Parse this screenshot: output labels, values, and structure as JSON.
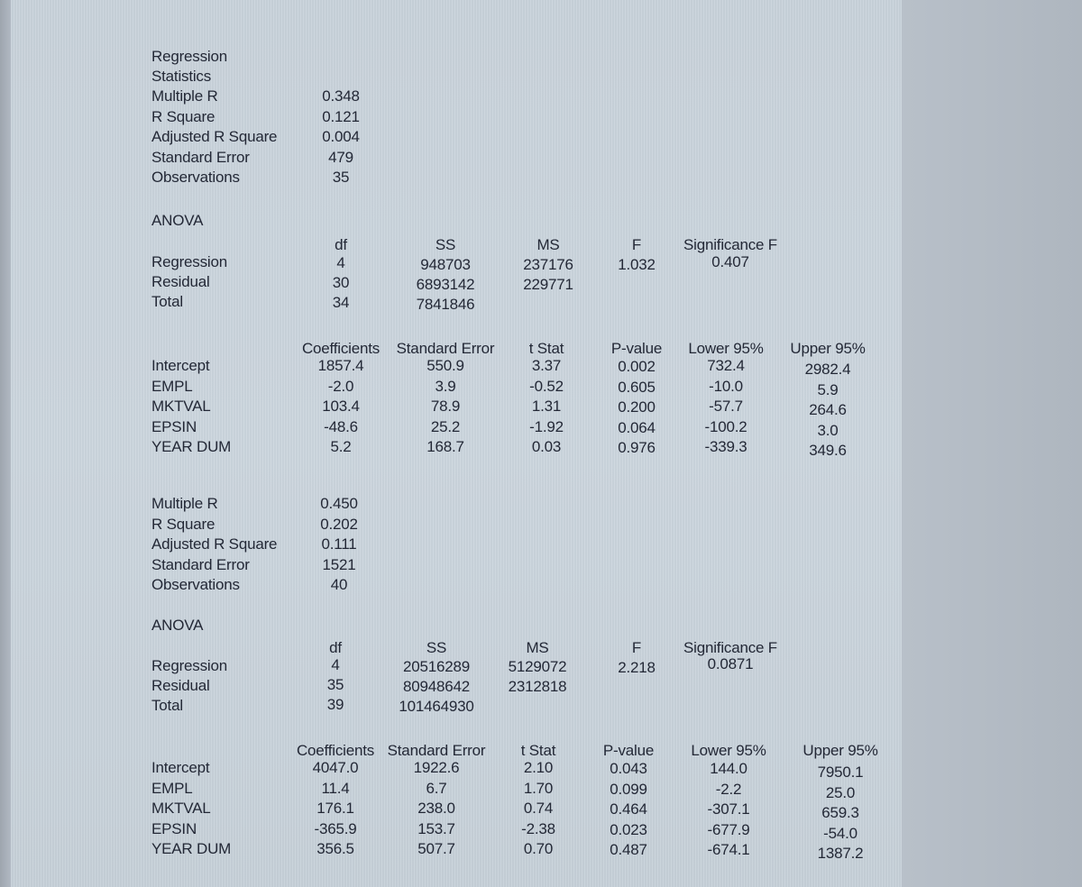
{
  "model1": {
    "stats_title_line1": "Regression",
    "stats_title_line2": "Statistics",
    "stats": [
      {
        "label": "Multiple R",
        "value": "0.348"
      },
      {
        "label": "R Square",
        "value": "0.121"
      },
      {
        "label": "Adjusted R Square",
        "value": "0.004"
      },
      {
        "label": "Standard Error",
        "value": "479"
      },
      {
        "label": "Observations",
        "value": "35"
      }
    ],
    "anova": {
      "title": "ANOVA",
      "headers": [
        "df",
        "SS",
        "MS",
        "F",
        "Significance F"
      ],
      "rows": [
        {
          "label": "Regression",
          "df": "4",
          "ss": "948703",
          "ms": "237176",
          "f": "1.032",
          "sig_f": "0.407"
        },
        {
          "label": "Residual",
          "df": "30",
          "ss": "6893142",
          "ms": "229771",
          "f": "",
          "sig_f": ""
        },
        {
          "label": "Total",
          "df": "34",
          "ss": "7841846",
          "ms": "",
          "f": "",
          "sig_f": ""
        }
      ]
    },
    "coefficients": {
      "headers": [
        "Coefficients",
        "Standard Error",
        "t Stat",
        "P-value",
        "Lower 95%",
        "Upper 95%"
      ],
      "rows": [
        {
          "label": "Intercept",
          "coef": "1857.4",
          "se": "550.9",
          "t": "3.37",
          "p": "0.002",
          "lower": "732.4",
          "upper": "2982.4"
        },
        {
          "label": "EMPL",
          "coef": "-2.0",
          "se": "3.9",
          "t": "-0.52",
          "p": "0.605",
          "lower": "-10.0",
          "upper": "5.9"
        },
        {
          "label": "MKTVAL",
          "coef": "103.4",
          "se": "78.9",
          "t": "1.31",
          "p": "0.200",
          "lower": "-57.7",
          "upper": "264.6"
        },
        {
          "label": "EPSIN",
          "coef": "-48.6",
          "se": "25.2",
          "t": "-1.92",
          "p": "0.064",
          "lower": "-100.2",
          "upper": "3.0"
        },
        {
          "label": "YEAR DUM",
          "coef": "5.2",
          "se": "168.7",
          "t": "0.03",
          "p": "0.976",
          "lower": "-339.3",
          "upper": "349.6"
        }
      ]
    }
  },
  "model2": {
    "stats": [
      {
        "label": "Multiple R",
        "value": "0.450"
      },
      {
        "label": "R Square",
        "value": "0.202"
      },
      {
        "label": "Adjusted R Square",
        "value": "0.111"
      },
      {
        "label": "Standard Error",
        "value": "1521"
      },
      {
        "label": "Observations",
        "value": "40"
      }
    ],
    "anova": {
      "title": "ANOVA",
      "headers": [
        "df",
        "SS",
        "MS",
        "F",
        "Significance F"
      ],
      "rows": [
        {
          "label": "Regression",
          "df": "4",
          "ss": "20516289",
          "ms": "5129072",
          "f": "2.218",
          "sig_f": "0.0871"
        },
        {
          "label": "Residual",
          "df": "35",
          "ss": "80948642",
          "ms": "2312818",
          "f": "",
          "sig_f": ""
        },
        {
          "label": "Total",
          "df": "39",
          "ss": "101464930",
          "ms": "",
          "f": "",
          "sig_f": ""
        }
      ]
    },
    "coefficients": {
      "headers": [
        "Coefficients",
        "Standard Error",
        "t Stat",
        "P-value",
        "Lower 95%",
        "Upper 95%"
      ],
      "rows": [
        {
          "label": "Intercept",
          "coef": "4047.0",
          "se": "1922.6",
          "t": "2.10",
          "p": "0.043",
          "lower": "144.0",
          "upper": "7950.1"
        },
        {
          "label": "EMPL",
          "coef": "11.4",
          "se": "6.7",
          "t": "1.70",
          "p": "0.099",
          "lower": "-2.2",
          "upper": "25.0"
        },
        {
          "label": "MKTVAL",
          "coef": "176.1",
          "se": "238.0",
          "t": "0.74",
          "p": "0.464",
          "lower": "-307.1",
          "upper": "659.3"
        },
        {
          "label": "EPSIN",
          "coef": "-365.9",
          "se": "153.7",
          "t": "-2.38",
          "p": "0.023",
          "lower": "-677.9",
          "upper": "-54.0"
        },
        {
          "label": "YEAR DUM",
          "coef": "356.5",
          "se": "507.7",
          "t": "0.70",
          "p": "0.487",
          "lower": "-674.1",
          "upper": "1387.2"
        }
      ]
    }
  }
}
